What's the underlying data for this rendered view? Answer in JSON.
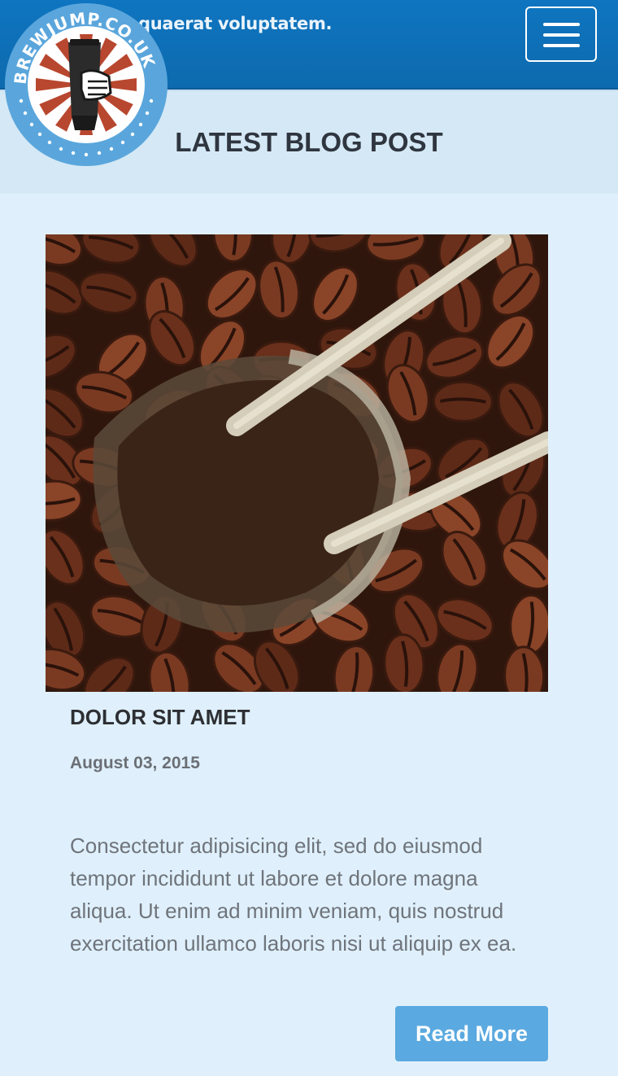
{
  "header": {
    "tagline": "quaerat voluptatem.",
    "menu_icon": "hamburger-menu-icon",
    "brand_color": "#0f75c0"
  },
  "logo": {
    "text": "BREWJUMP.CO.UK",
    "icon": "hand-holding-cup-logo"
  },
  "section": {
    "title": "LATEST BLOG POST"
  },
  "post": {
    "image_icon": "coffee-beans-scoop-photo",
    "title": "DOLOR SIT AMET",
    "date": "August 03, 2015",
    "excerpt": "Consectetur adipisicing elit, sed do eiusmod tempor incididunt ut labore et dolore magna aliqua. Ut enim ad minim veniam, quis nostrud exercitation ullamco laboris nisi ut aliquip ex ea.",
    "read_more_label": "Read More",
    "button_color": "#5aa9e0"
  }
}
